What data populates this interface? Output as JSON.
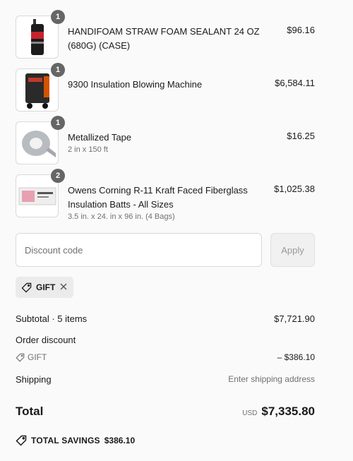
{
  "line_items": [
    {
      "qty": "1",
      "title": "HANDIFOAM STRAW FOAM SEALANT 24 OZ (680G) (CASE)",
      "variant": "",
      "price": "$96.16",
      "thumb": "foam-can-image"
    },
    {
      "qty": "1",
      "title": "9300 Insulation Blowing Machine",
      "variant": "",
      "price": "$6,584.11",
      "thumb": "blowing-machine-image"
    },
    {
      "qty": "1",
      "title": "Metallized Tape",
      "variant": "2 in x 150 ft",
      "price": "$16.25",
      "thumb": "tape-roll-image"
    },
    {
      "qty": "2",
      "title": "Owens Corning R-11 Kraft Faced Fiberglass Insulation Batts - All Sizes",
      "variant": "3.5 in. x 24. in x 96 in. (4 Bags)",
      "price": "$1,025.38",
      "thumb": "insulation-bag-image"
    }
  ],
  "discount": {
    "placeholder": "Discount code",
    "apply_label": "Apply",
    "applied_code": "GIFT"
  },
  "summary": {
    "subtotal_label": "Subtotal · 5 items",
    "subtotal_value": "$7,721.90",
    "order_discount_label": "Order discount",
    "discount_code": "GIFT",
    "discount_value": "– $386.10",
    "shipping_label": "Shipping",
    "shipping_value": "Enter shipping address",
    "total_label": "Total",
    "currency": "USD",
    "total_value": "$7,335.80",
    "savings_label": "TOTAL SAVINGS",
    "savings_value": "$386.10"
  },
  "colors": {
    "badge": "#666666",
    "muted_text": "#707070",
    "chip_bg": "#ebebeb"
  },
  "icons": [
    "tag-icon",
    "close-icon"
  ]
}
